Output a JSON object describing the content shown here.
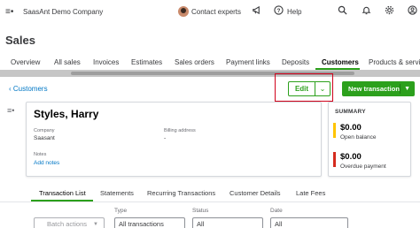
{
  "topbar": {
    "company": "SaasAnt Demo Company",
    "contact": "Contact experts",
    "help": "Help"
  },
  "page": {
    "title": "Sales"
  },
  "tabs": [
    {
      "label": "Overview"
    },
    {
      "label": "All sales"
    },
    {
      "label": "Invoices"
    },
    {
      "label": "Estimates"
    },
    {
      "label": "Sales orders"
    },
    {
      "label": "Payment links"
    },
    {
      "label": "Deposits"
    },
    {
      "label": "Customers"
    },
    {
      "label": "Products & servic"
    }
  ],
  "active_tab": "Customers",
  "breadcrumb": {
    "label": "Customers"
  },
  "actions": {
    "edit": "Edit",
    "new_transaction": "New transaction"
  },
  "customer": {
    "name": "Styles, Harry",
    "company_label": "Company",
    "company_value": "Saasant",
    "billing_label": "Billing address",
    "billing_value": "-",
    "notes_label": "Notes",
    "add_notes": "Add notes"
  },
  "summary": {
    "title": "SUMMARY",
    "open_balance_amount": "$0.00",
    "open_balance_label": "Open balance",
    "overdue_amount": "$0.00",
    "overdue_label": "Overdue payment",
    "open_color": "#ffc400",
    "overdue_color": "#d52b1e"
  },
  "subtabs": [
    {
      "label": "Transaction List"
    },
    {
      "label": "Statements"
    },
    {
      "label": "Recurring Transactions"
    },
    {
      "label": "Customer Details"
    },
    {
      "label": "Late Fees"
    }
  ],
  "filters": {
    "batch_actions": "Batch actions",
    "type_label": "Type",
    "type_value": "All transactions",
    "status_label": "Status",
    "status_value": "All",
    "date_label": "Date",
    "date_value": "All"
  },
  "colors": {
    "accent": "#2ca01c",
    "link": "#0077c5",
    "highlight": "#d0021b"
  }
}
